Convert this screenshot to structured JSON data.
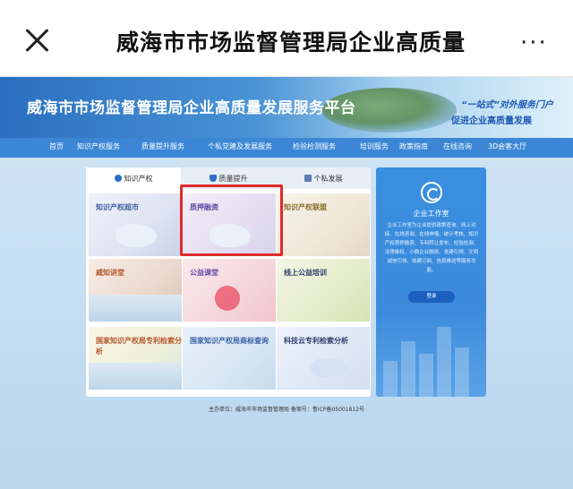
{
  "app": {
    "title": "威海市市场监督管理局企业高质量",
    "close_icon": "close-icon",
    "more_icon": "more-icon",
    "more_text": "···"
  },
  "banner": {
    "title": "威海市市场监督管理局企业高质量发展服务平台",
    "slogan_line1": "“一站式”对外服务门户",
    "slogan_line2": "促进企业高质量发展"
  },
  "nav": {
    "items": [
      "首页",
      "知识产权服务",
      "质量提升服务",
      "个私党建及发展服务",
      "检验检测服务",
      "培训服务",
      "政策指南",
      "在线咨询",
      "3D会客大厅"
    ]
  },
  "tabs": [
    {
      "label": "知识产权",
      "icon": "award-icon"
    },
    {
      "label": "质量提升",
      "icon": "shield-icon"
    },
    {
      "label": "个私发展",
      "icon": "document-icon"
    }
  ],
  "tiles": [
    {
      "label": "知识产权超市"
    },
    {
      "label": "质押融资"
    },
    {
      "label": "知识产权联盟"
    },
    {
      "label": "威知讲堂"
    },
    {
      "label": "公益课堂"
    },
    {
      "label": "线上公益培训"
    },
    {
      "label": "国家知识产权局专利检索分析"
    },
    {
      "label": "国家知识产权局商标查询"
    },
    {
      "label": "科技云专利检索分析"
    }
  ],
  "workstation": {
    "title": "企业工作室",
    "description": "企业工作室为企业提供政策查询、网上对接、在线咨询、在线申报、统计考核、知识产权质押融资、专利转让发布、检验检测、法律维权、小微企业融资、党建引领、文明诚信引领、收藏订阅、信息推送等服务功能。",
    "login_label": "登录",
    "icon": "workstation-icon"
  },
  "footer": {
    "text": "主办单位：威海市市场监督管理局 备案号：鲁ICP备05001812号"
  },
  "colors": {
    "nav_bar": "#3b87d6",
    "banner_start": "#2a6fbf",
    "side_panel": "#3a8fe0",
    "highlight": "#e12a2a"
  }
}
